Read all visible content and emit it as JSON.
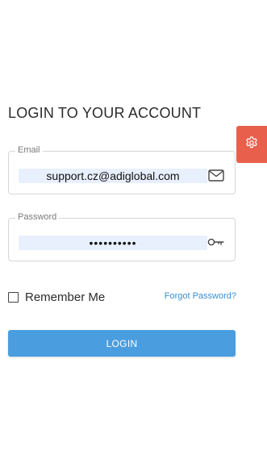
{
  "title": "LOGIN TO YOUR ACCOUNT",
  "settings": {
    "icon": "gear-icon",
    "color": "#e8604c"
  },
  "email": {
    "label": "Email",
    "value": "support.cz@adiglobal.com",
    "icon": "envelope-icon"
  },
  "password": {
    "label": "Password",
    "value": "••••••••••",
    "icon": "key-icon"
  },
  "remember": {
    "label": "Remember Me",
    "checked": false
  },
  "forgot": {
    "label": "Forgot Password?"
  },
  "login": {
    "label": "LOGIN",
    "color": "#4a9ee0"
  },
  "colors": {
    "link": "#3a8fd6",
    "autofill_bg": "#e8f0fe"
  }
}
